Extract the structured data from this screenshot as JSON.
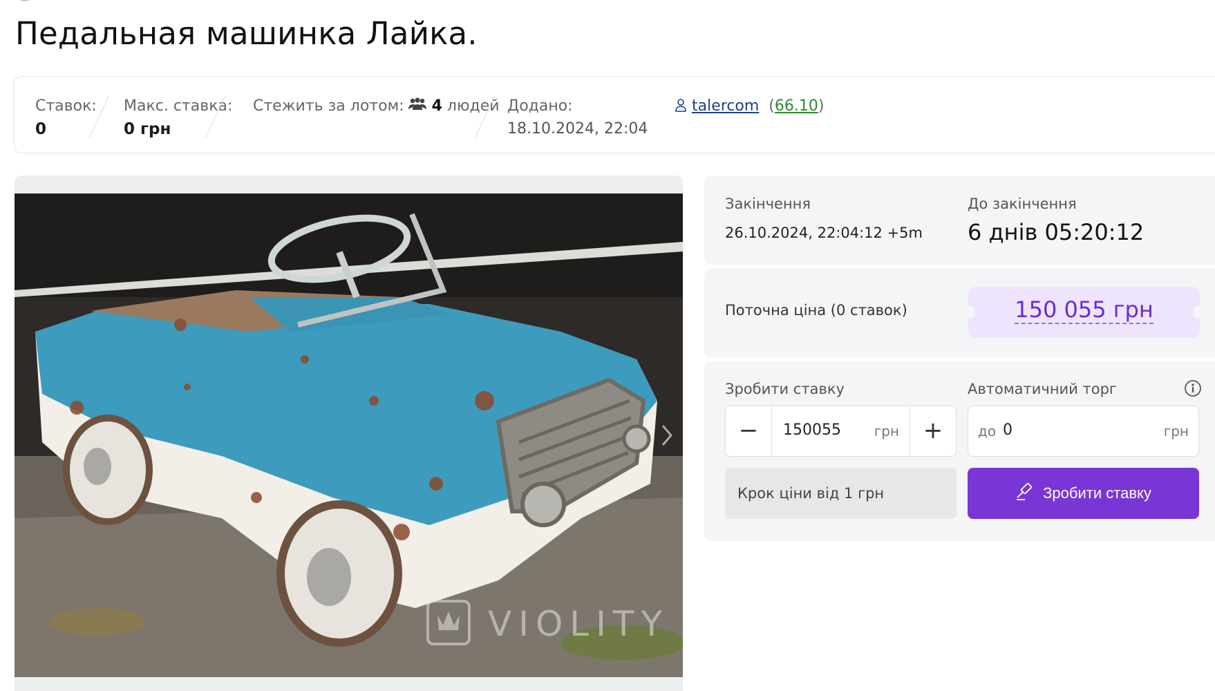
{
  "lot": {
    "title": "Педальная машинка Лайка.",
    "photo_watermark": "VIOLITY"
  },
  "stats": {
    "bids_label": "Ставок:",
    "bids_value": "0",
    "max_bid_label": "Макс. ставка:",
    "max_bid_value": "0 грн",
    "watchers_label": "Стежить за лотом:",
    "watchers_count": "4",
    "watchers_unit": "людей",
    "added_label": "Додано:",
    "added_value": "18.10.2024, 22:04",
    "seller_name": "talercom",
    "seller_rating": "66.10"
  },
  "ending": {
    "end_label": "Закінчення",
    "end_value": "26.10.2024, 22:04:12 +5m",
    "countdown_label": "До закінчення",
    "countdown_value": "6 днів 05:20:12"
  },
  "price": {
    "label": "Поточна ціна (0 ставок)",
    "value": "150 055 грн"
  },
  "bid": {
    "label": "Зробити ставку",
    "minus": "−",
    "plus": "+",
    "amount": "150055",
    "unit": "грн",
    "auto_label": "Автоматичний торг",
    "auto_prefix": "до",
    "auto_value": "0",
    "auto_unit": "грн",
    "step_note": "Крок ціни від 1 грн",
    "submit_label": "Зробити ставку"
  },
  "colors": {
    "accent": "#7a35d6",
    "price_bg": "#efe4fd",
    "price_text": "#6a2bd1",
    "panel_bg": "#f4f5f6",
    "link": "#1c3f8c",
    "rating": "#2a8d2a"
  },
  "icons": {
    "watchers": "users-icon",
    "seller": "user-icon",
    "info": "info-icon",
    "bid": "gavel-icon"
  }
}
